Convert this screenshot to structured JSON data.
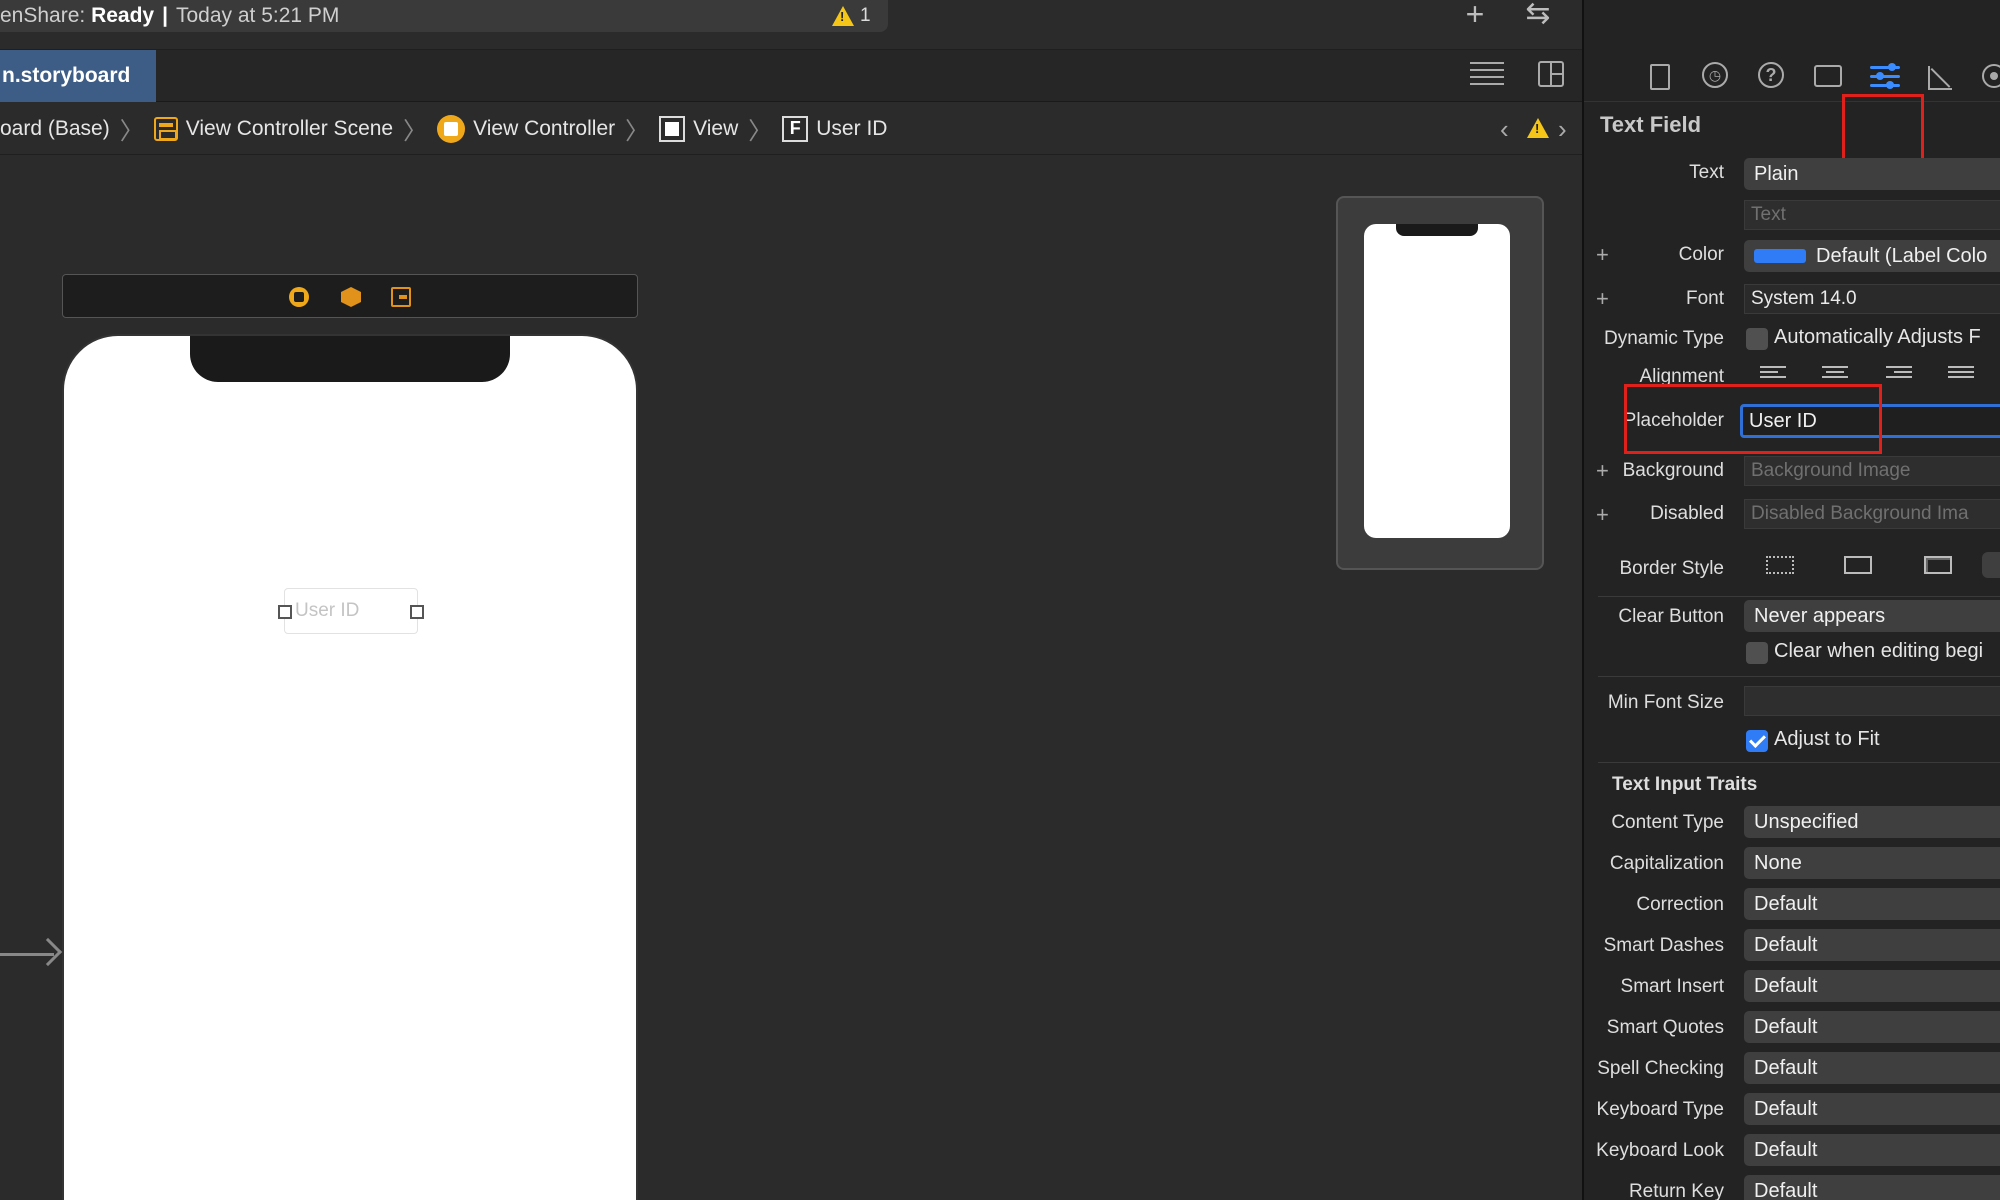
{
  "status": {
    "app_fragment": "enShare:",
    "state": "Ready",
    "time": "Today at 5:21 PM",
    "warning_count": "1"
  },
  "tab": {
    "file_name": "n.storyboard"
  },
  "breadcrumb": {
    "items": [
      "oard (Base)",
      "View Controller Scene",
      "View Controller",
      "View",
      "User ID"
    ]
  },
  "canvas": {
    "textfield_placeholder": "User ID"
  },
  "inspector": {
    "title": "Text Field",
    "text_label": "Text",
    "text_value": "Plain",
    "text_placeholder": "Text",
    "color_label": "Color",
    "color_value": "Default (Label Colo",
    "color_swatch": "#2f7cf6",
    "font_label": "Font",
    "font_value": "System 14.0",
    "dynamic_type_label": "Dynamic Type",
    "dynamic_type_check": "Automatically Adjusts F",
    "alignment_label": "Alignment",
    "placeholder_label": "Placeholder",
    "placeholder_value": "User ID",
    "background_label": "Background",
    "background_placeholder": "Background Image",
    "disabled_label": "Disabled",
    "disabled_placeholder": "Disabled Background Ima",
    "border_style_label": "Border Style",
    "clear_button_label": "Clear Button",
    "clear_button_value": "Never appears",
    "clear_editing_check": "Clear when editing begi",
    "min_font_label": "Min Font Size",
    "adjust_fit_check": "Adjust to Fit",
    "traits_title": "Text Input Traits",
    "traits": [
      {
        "label": "Content Type",
        "value": "Unspecified"
      },
      {
        "label": "Capitalization",
        "value": "None"
      },
      {
        "label": "Correction",
        "value": "Default"
      },
      {
        "label": "Smart Dashes",
        "value": "Default"
      },
      {
        "label": "Smart Insert",
        "value": "Default"
      },
      {
        "label": "Smart Quotes",
        "value": "Default"
      },
      {
        "label": "Spell Checking",
        "value": "Default"
      },
      {
        "label": "Keyboard Type",
        "value": "Default"
      },
      {
        "label": "Keyboard Look",
        "value": "Default"
      },
      {
        "label": "Return Key",
        "value": "Default"
      }
    ]
  },
  "colors": {
    "highlight_red": "#e0201b",
    "accent_blue": "#2f7cf6",
    "warning_yellow": "#f5c518"
  }
}
